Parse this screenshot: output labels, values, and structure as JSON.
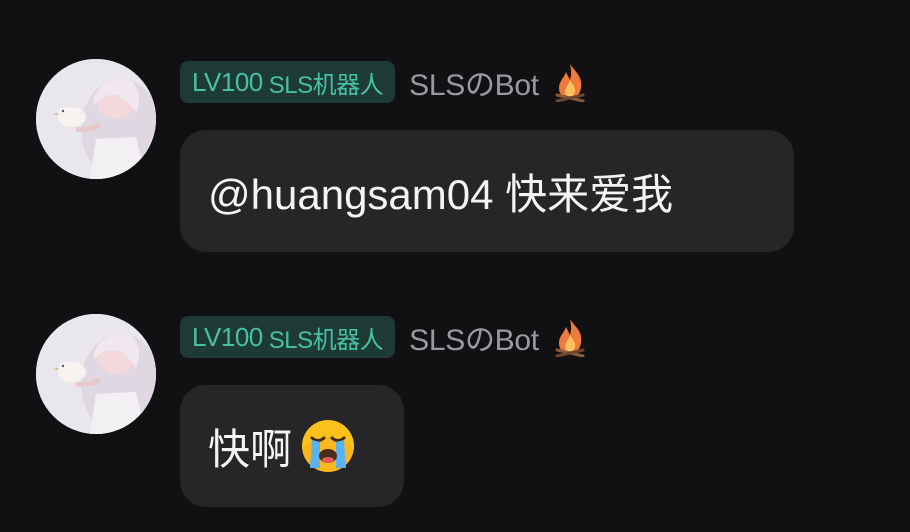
{
  "messages": [
    {
      "level_badge": "LV100",
      "role_badge": "SLS机器人",
      "username": "SLSのBot",
      "status_icon": "fire-icon",
      "text": "@huangsam04 快来爱我",
      "emoji": null
    },
    {
      "level_badge": "LV100",
      "role_badge": "SLS机器人",
      "username": "SLSのBot",
      "status_icon": "fire-icon",
      "text": "快啊",
      "emoji": "crying-face-emoji"
    }
  ],
  "colors": {
    "background": "#111113",
    "bubble": "#262628",
    "badge_bg": "#1d3a35",
    "badge_text": "#49c0a6",
    "username": "#9a9a9e",
    "message_text": "#f3f3f3"
  }
}
